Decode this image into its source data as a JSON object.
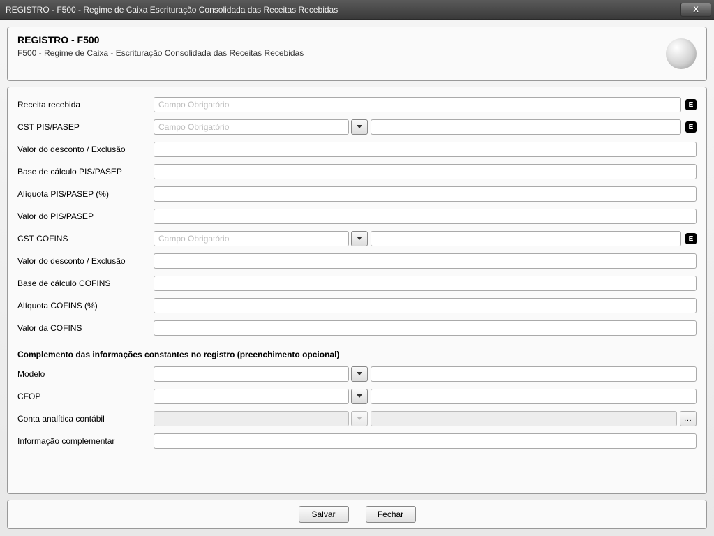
{
  "window": {
    "title": "REGISTRO - F500 - Regime de Caixa  Escrituração Consolidada das Receitas Recebidas"
  },
  "header": {
    "title": "REGISTRO - F500",
    "subtitle": "F500 - Regime de Caixa - Escrituração Consolidada das Receitas Recebidas"
  },
  "placeholders": {
    "required": "Campo Obrigatório"
  },
  "fields": {
    "receita_recebida": {
      "label": "Receita recebida",
      "value": ""
    },
    "cst_pis": {
      "label": "CST PIS/PASEP",
      "code": "",
      "desc": ""
    },
    "vl_desc_pis": {
      "label": "Valor do desconto / Exclusão",
      "value": ""
    },
    "bc_pis": {
      "label": "Base de cálculo PIS/PASEP",
      "value": ""
    },
    "aliq_pis": {
      "label": "Alíquota PIS/PASEP (%)",
      "value": ""
    },
    "vl_pis": {
      "label": "Valor do PIS/PASEP",
      "value": ""
    },
    "cst_cofins": {
      "label": "CST COFINS",
      "code": "",
      "desc": ""
    },
    "vl_desc_cofins": {
      "label": "Valor do desconto / Exclusão",
      "value": ""
    },
    "bc_cofins": {
      "label": "Base de cálculo COFINS",
      "value": ""
    },
    "aliq_cofins": {
      "label": "Alíquota COFINS (%)",
      "value": ""
    },
    "vl_cofins": {
      "label": "Valor da COFINS",
      "value": ""
    }
  },
  "section2": {
    "title": "Complemento das informações constantes no registro (preenchimento opcional)",
    "modelo": {
      "label": "Modelo",
      "code": "",
      "desc": ""
    },
    "cfop": {
      "label": "CFOP",
      "code": "",
      "desc": ""
    },
    "conta": {
      "label": "Conta analítica contábil",
      "code": "",
      "desc": ""
    },
    "info": {
      "label": "Informação complementar",
      "value": ""
    }
  },
  "buttons": {
    "save": "Salvar",
    "close": "Fechar"
  },
  "badges": {
    "e": "E"
  }
}
